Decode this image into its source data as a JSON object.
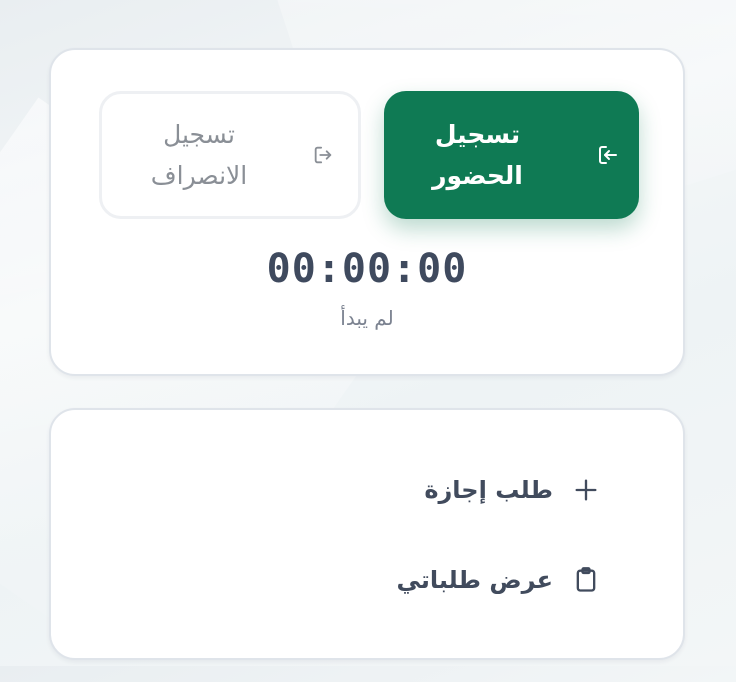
{
  "attendance": {
    "check_in_label": "تسجيل الحضور",
    "check_out_label": "تسجيل الانصراف",
    "timer": "00:00:00",
    "status": "لم يبدأ"
  },
  "actions": {
    "leave_request_label": "طلب إجازة",
    "my_requests_label": "عرض طلباتي"
  },
  "icons": {
    "check_in": "login-icon",
    "check_out": "logout-icon",
    "leave_request": "plus-icon",
    "my_requests": "clipboard-icon"
  },
  "colors": {
    "primary": "#0f7a54",
    "text_dark": "#414b5d",
    "text_muted": "#7b8290"
  }
}
